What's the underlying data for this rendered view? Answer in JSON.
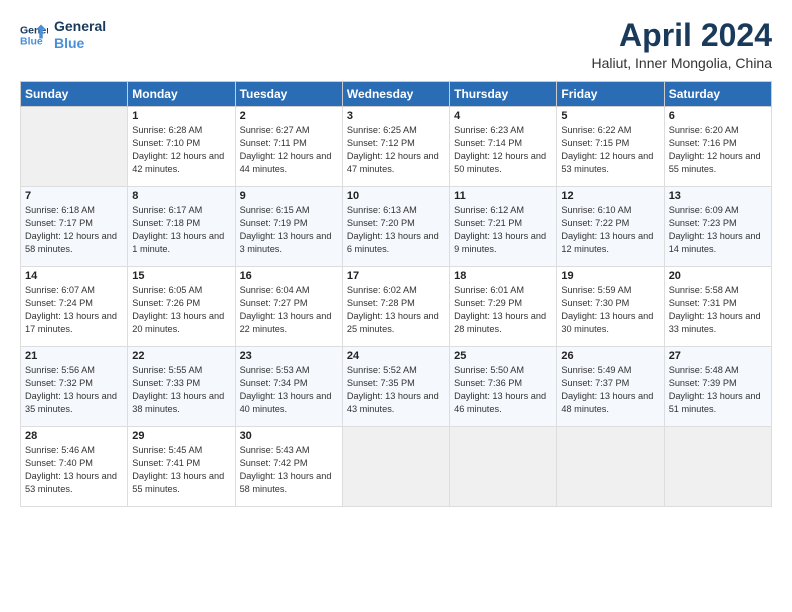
{
  "header": {
    "logo_line1": "General",
    "logo_line2": "Blue",
    "month": "April 2024",
    "location": "Haliut, Inner Mongolia, China"
  },
  "days_of_week": [
    "Sunday",
    "Monday",
    "Tuesday",
    "Wednesday",
    "Thursday",
    "Friday",
    "Saturday"
  ],
  "weeks": [
    [
      {
        "day": "",
        "empty": true
      },
      {
        "day": "1",
        "sunrise": "Sunrise: 6:28 AM",
        "sunset": "Sunset: 7:10 PM",
        "daylight": "Daylight: 12 hours and 42 minutes."
      },
      {
        "day": "2",
        "sunrise": "Sunrise: 6:27 AM",
        "sunset": "Sunset: 7:11 PM",
        "daylight": "Daylight: 12 hours and 44 minutes."
      },
      {
        "day": "3",
        "sunrise": "Sunrise: 6:25 AM",
        "sunset": "Sunset: 7:12 PM",
        "daylight": "Daylight: 12 hours and 47 minutes."
      },
      {
        "day": "4",
        "sunrise": "Sunrise: 6:23 AM",
        "sunset": "Sunset: 7:14 PM",
        "daylight": "Daylight: 12 hours and 50 minutes."
      },
      {
        "day": "5",
        "sunrise": "Sunrise: 6:22 AM",
        "sunset": "Sunset: 7:15 PM",
        "daylight": "Daylight: 12 hours and 53 minutes."
      },
      {
        "day": "6",
        "sunrise": "Sunrise: 6:20 AM",
        "sunset": "Sunset: 7:16 PM",
        "daylight": "Daylight: 12 hours and 55 minutes."
      }
    ],
    [
      {
        "day": "7",
        "sunrise": "Sunrise: 6:18 AM",
        "sunset": "Sunset: 7:17 PM",
        "daylight": "Daylight: 12 hours and 58 minutes."
      },
      {
        "day": "8",
        "sunrise": "Sunrise: 6:17 AM",
        "sunset": "Sunset: 7:18 PM",
        "daylight": "Daylight: 13 hours and 1 minute."
      },
      {
        "day": "9",
        "sunrise": "Sunrise: 6:15 AM",
        "sunset": "Sunset: 7:19 PM",
        "daylight": "Daylight: 13 hours and 3 minutes."
      },
      {
        "day": "10",
        "sunrise": "Sunrise: 6:13 AM",
        "sunset": "Sunset: 7:20 PM",
        "daylight": "Daylight: 13 hours and 6 minutes."
      },
      {
        "day": "11",
        "sunrise": "Sunrise: 6:12 AM",
        "sunset": "Sunset: 7:21 PM",
        "daylight": "Daylight: 13 hours and 9 minutes."
      },
      {
        "day": "12",
        "sunrise": "Sunrise: 6:10 AM",
        "sunset": "Sunset: 7:22 PM",
        "daylight": "Daylight: 13 hours and 12 minutes."
      },
      {
        "day": "13",
        "sunrise": "Sunrise: 6:09 AM",
        "sunset": "Sunset: 7:23 PM",
        "daylight": "Daylight: 13 hours and 14 minutes."
      }
    ],
    [
      {
        "day": "14",
        "sunrise": "Sunrise: 6:07 AM",
        "sunset": "Sunset: 7:24 PM",
        "daylight": "Daylight: 13 hours and 17 minutes."
      },
      {
        "day": "15",
        "sunrise": "Sunrise: 6:05 AM",
        "sunset": "Sunset: 7:26 PM",
        "daylight": "Daylight: 13 hours and 20 minutes."
      },
      {
        "day": "16",
        "sunrise": "Sunrise: 6:04 AM",
        "sunset": "Sunset: 7:27 PM",
        "daylight": "Daylight: 13 hours and 22 minutes."
      },
      {
        "day": "17",
        "sunrise": "Sunrise: 6:02 AM",
        "sunset": "Sunset: 7:28 PM",
        "daylight": "Daylight: 13 hours and 25 minutes."
      },
      {
        "day": "18",
        "sunrise": "Sunrise: 6:01 AM",
        "sunset": "Sunset: 7:29 PM",
        "daylight": "Daylight: 13 hours and 28 minutes."
      },
      {
        "day": "19",
        "sunrise": "Sunrise: 5:59 AM",
        "sunset": "Sunset: 7:30 PM",
        "daylight": "Daylight: 13 hours and 30 minutes."
      },
      {
        "day": "20",
        "sunrise": "Sunrise: 5:58 AM",
        "sunset": "Sunset: 7:31 PM",
        "daylight": "Daylight: 13 hours and 33 minutes."
      }
    ],
    [
      {
        "day": "21",
        "sunrise": "Sunrise: 5:56 AM",
        "sunset": "Sunset: 7:32 PM",
        "daylight": "Daylight: 13 hours and 35 minutes."
      },
      {
        "day": "22",
        "sunrise": "Sunrise: 5:55 AM",
        "sunset": "Sunset: 7:33 PM",
        "daylight": "Daylight: 13 hours and 38 minutes."
      },
      {
        "day": "23",
        "sunrise": "Sunrise: 5:53 AM",
        "sunset": "Sunset: 7:34 PM",
        "daylight": "Daylight: 13 hours and 40 minutes."
      },
      {
        "day": "24",
        "sunrise": "Sunrise: 5:52 AM",
        "sunset": "Sunset: 7:35 PM",
        "daylight": "Daylight: 13 hours and 43 minutes."
      },
      {
        "day": "25",
        "sunrise": "Sunrise: 5:50 AM",
        "sunset": "Sunset: 7:36 PM",
        "daylight": "Daylight: 13 hours and 46 minutes."
      },
      {
        "day": "26",
        "sunrise": "Sunrise: 5:49 AM",
        "sunset": "Sunset: 7:37 PM",
        "daylight": "Daylight: 13 hours and 48 minutes."
      },
      {
        "day": "27",
        "sunrise": "Sunrise: 5:48 AM",
        "sunset": "Sunset: 7:39 PM",
        "daylight": "Daylight: 13 hours and 51 minutes."
      }
    ],
    [
      {
        "day": "28",
        "sunrise": "Sunrise: 5:46 AM",
        "sunset": "Sunset: 7:40 PM",
        "daylight": "Daylight: 13 hours and 53 minutes."
      },
      {
        "day": "29",
        "sunrise": "Sunrise: 5:45 AM",
        "sunset": "Sunset: 7:41 PM",
        "daylight": "Daylight: 13 hours and 55 minutes."
      },
      {
        "day": "30",
        "sunrise": "Sunrise: 5:43 AM",
        "sunset": "Sunset: 7:42 PM",
        "daylight": "Daylight: 13 hours and 58 minutes."
      },
      {
        "day": "",
        "empty": true
      },
      {
        "day": "",
        "empty": true
      },
      {
        "day": "",
        "empty": true
      },
      {
        "day": "",
        "empty": true
      }
    ]
  ]
}
